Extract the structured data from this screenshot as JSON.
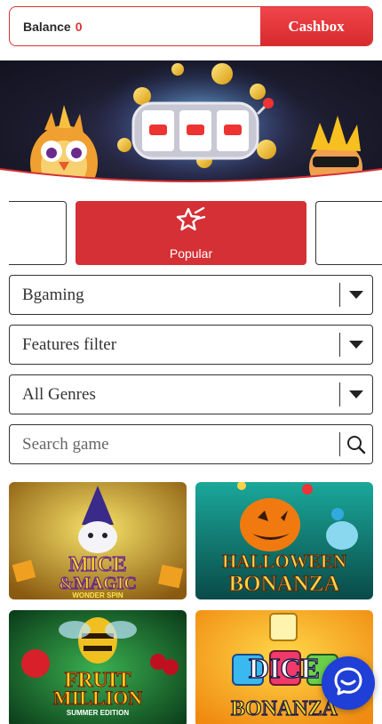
{
  "header": {
    "balance_label": "Balance",
    "balance_value": "0",
    "cashbox_label": "Cashbox"
  },
  "categories": {
    "active_label": "Popular",
    "active_icon": "star-icon"
  },
  "filters": {
    "provider": "Bgaming",
    "features": "Features filter",
    "genres": "All Genres",
    "search_placeholder": "Search game"
  },
  "games": [
    {
      "title_line1": "MICE",
      "title_line2": "&MAGIC",
      "subtitle": "WONDER SPIN"
    },
    {
      "title_line1": "HALLOWEEN",
      "title_line2": "BONANZA"
    },
    {
      "title_line1": "FRUIT",
      "title_line2": "MILLION",
      "subtitle": "SUMMER EDITION"
    },
    {
      "title_line1": "DICE",
      "title_line2": "BONANZA"
    }
  ],
  "colors": {
    "accent_red": "#d53035",
    "chat_blue": "#1f3fd6"
  }
}
